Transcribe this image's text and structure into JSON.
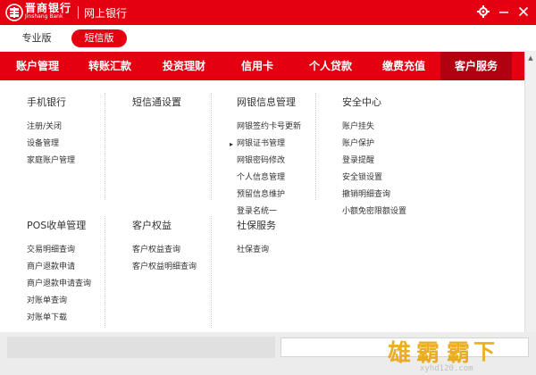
{
  "titlebar": {
    "brand_cn": "晋商银行",
    "brand_en": "Jinshang Bank",
    "title": "网上银行",
    "settings_icon": "gear-icon",
    "minimize_icon": "minimize-icon",
    "close_icon": "close-icon",
    "accent_color": "#e50011"
  },
  "version_tabs": [
    {
      "label": "专业版",
      "active": false
    },
    {
      "label": "短信版",
      "active": true
    }
  ],
  "nav": {
    "items": [
      {
        "label": "账户管理",
        "active": false
      },
      {
        "label": "转账汇款",
        "active": false
      },
      {
        "label": "投资理财",
        "active": false
      },
      {
        "label": "信用卡",
        "active": false
      },
      {
        "label": "个人贷款",
        "active": false
      },
      {
        "label": "缴费充值",
        "active": false
      },
      {
        "label": "客户服务",
        "active": true
      }
    ],
    "active_color": "#b10010"
  },
  "menu": {
    "mobile": {
      "title": "手机银行",
      "links": [
        "注册/关闭",
        "设备管理",
        "家庭账户管理"
      ]
    },
    "sms": {
      "title": "短信通设置",
      "links": []
    },
    "netbank": {
      "title": "网银信息管理",
      "links": [
        "网银签约卡号更新",
        "网银证书管理",
        "网银密码修改",
        "个人信息管理",
        "预留信息维护",
        "登录名统一"
      ]
    },
    "security": {
      "title": "安全中心",
      "links": [
        "账户挂失",
        "账户保护",
        "登录提醒",
        "安全锁设置",
        "撤销明细查询",
        "小额免密限额设置"
      ]
    },
    "pos": {
      "title": "POS收单管理",
      "links": [
        "交易明细查询",
        "商户退款申请",
        "商户退款申请查询",
        "对账单查询",
        "对账单下载"
      ]
    },
    "rights": {
      "title": "客户权益",
      "links": [
        "客户权益查询",
        "客户权益明细查询"
      ]
    },
    "social": {
      "title": "社保服务",
      "links": [
        "社保查询"
      ]
    }
  },
  "scrollbar": {
    "up_icon": "arrow-up-icon",
    "down_icon": "arrow-down-icon"
  },
  "watermark_text": "雄霸 xyhd120.com"
}
